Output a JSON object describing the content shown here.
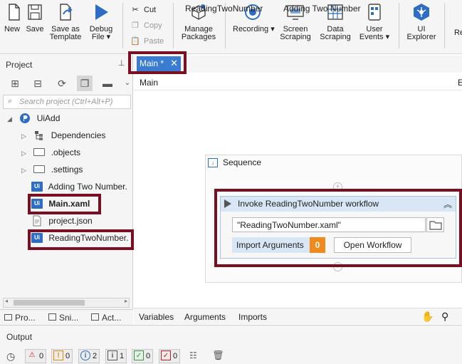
{
  "ribbon": {
    "new": "New",
    "save": "Save",
    "save_as_template": [
      "Save as",
      "Template"
    ],
    "debug_file": [
      "Debug",
      "File ▾"
    ],
    "cut": "Cut",
    "copy": "Copy",
    "paste": "Paste",
    "manage_packages": [
      "Manage",
      "Packages"
    ],
    "recording": "Recording ▾",
    "screen_scraping": [
      "Screen",
      "Scraping"
    ],
    "data_scraping": [
      "Data",
      "Scraping"
    ],
    "user_events": [
      "User",
      "Events ▾"
    ],
    "ui_explorer": [
      "UI",
      "Explorer"
    ],
    "cut_off": "Re"
  },
  "project_panel": {
    "title": "Project",
    "search_placeholder": "Search project (Ctrl+Alt+P)",
    "tree": [
      {
        "label": "UiAdd",
        "icon": "project-icon"
      },
      {
        "label": "Dependencies",
        "icon": "dependencies-icon"
      },
      {
        "label": ".objects",
        "icon": "folder-icon"
      },
      {
        "label": ".settings",
        "icon": "folder-icon"
      },
      {
        "label": "Adding Two Number.",
        "icon": "ui-file-icon"
      },
      {
        "label": "Main.xaml",
        "icon": "ui-file-icon"
      },
      {
        "label": "project.json",
        "icon": "json-file-icon"
      },
      {
        "label": "ReadingTwoNumber.",
        "icon": "ui-file-icon"
      }
    ],
    "bottom_tabs": [
      "Pro...",
      "Sni...",
      "Act..."
    ]
  },
  "doc_tabs": [
    {
      "label": "Main *",
      "active": true
    },
    {
      "label": "ReadingTwoNumber",
      "active": false
    },
    {
      "label": "Adding Two Number",
      "active": false
    }
  ],
  "breadcrumb": "Main",
  "breadcrumb_right_cut": "E",
  "designer": {
    "sequence_label": "Sequence",
    "activity_title": "Invoke ReadingTwoNumber workflow",
    "workflow_path": "\"ReadingTwoNumber.xaml\"",
    "import_arguments": "Import Arguments",
    "argument_count": "0",
    "open_workflow": "Open Workflow"
  },
  "designer_bottom_tabs": [
    "Variables",
    "Arguments",
    "Imports"
  ],
  "output": {
    "title": "Output",
    "filters": [
      {
        "icon": "error-icon",
        "count": "0"
      },
      {
        "icon": "warning-icon",
        "count": "0"
      },
      {
        "icon": "info-icon",
        "count": "2"
      },
      {
        "icon": "trace-icon",
        "count": "1"
      },
      {
        "icon": "success-icon",
        "count": "0"
      },
      {
        "icon": "failure-icon",
        "count": "0"
      }
    ]
  },
  "colors": {
    "accent": "#3a7cd1",
    "highlight": "#7a0e22",
    "badge": "#f08a1c",
    "activity_header": "#d8e6f6"
  }
}
